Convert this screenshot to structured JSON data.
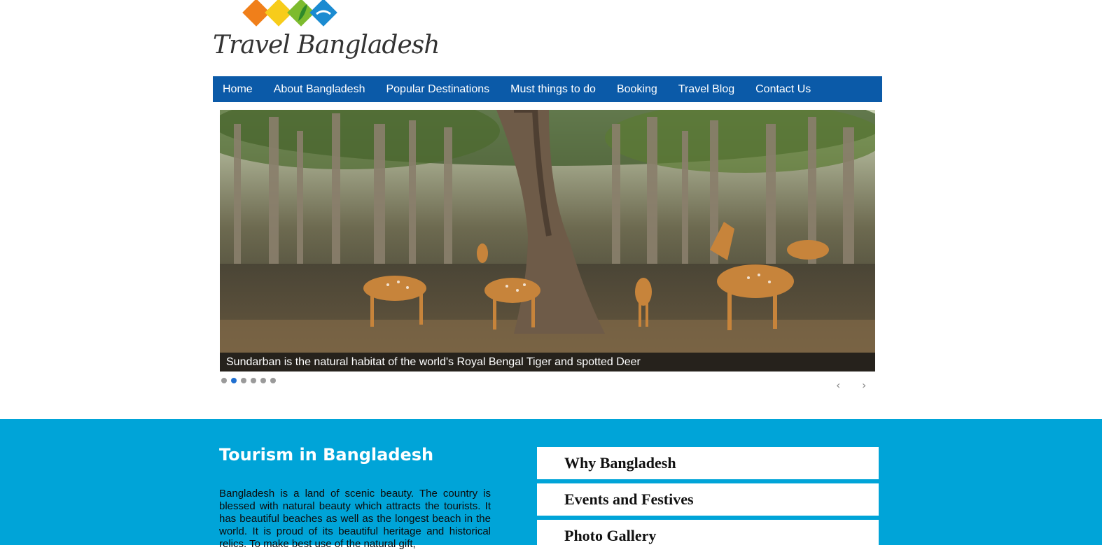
{
  "logo": {
    "text": "Travel Bangladesh",
    "colors": [
      "#f07f1a",
      "#f7cc1b",
      "#7dbb2e",
      "#1b8bd1"
    ]
  },
  "nav": {
    "items": [
      {
        "label": "Home"
      },
      {
        "label": "About Bangladesh"
      },
      {
        "label": "Popular Destinations"
      },
      {
        "label": "Must things to do"
      },
      {
        "label": "Booking"
      },
      {
        "label": "Travel Blog"
      },
      {
        "label": "Contact Us"
      }
    ],
    "background": "#0b5aa8"
  },
  "slider": {
    "caption": "Sundarban is the natural habitat of the world's Royal Bengal Tiger and spotted Deer",
    "total_slides": 6,
    "active_slide": 2,
    "prev_icon": "‹",
    "next_icon": "›"
  },
  "section": {
    "background": "#00a4d8",
    "title": "Tourism in Bangladesh",
    "body": "Bangladesh is a land of scenic beauty. The country is blessed with natural beauty which attracts the tourists. It has beautiful beaches as well as the longest beach in the world. It is proud of its beautiful heritage and historical relics. To make best use of the natural gift,",
    "links": [
      {
        "label": "Why Bangladesh"
      },
      {
        "label": "Events and Festives"
      },
      {
        "label": "Photo Gallery"
      }
    ]
  }
}
